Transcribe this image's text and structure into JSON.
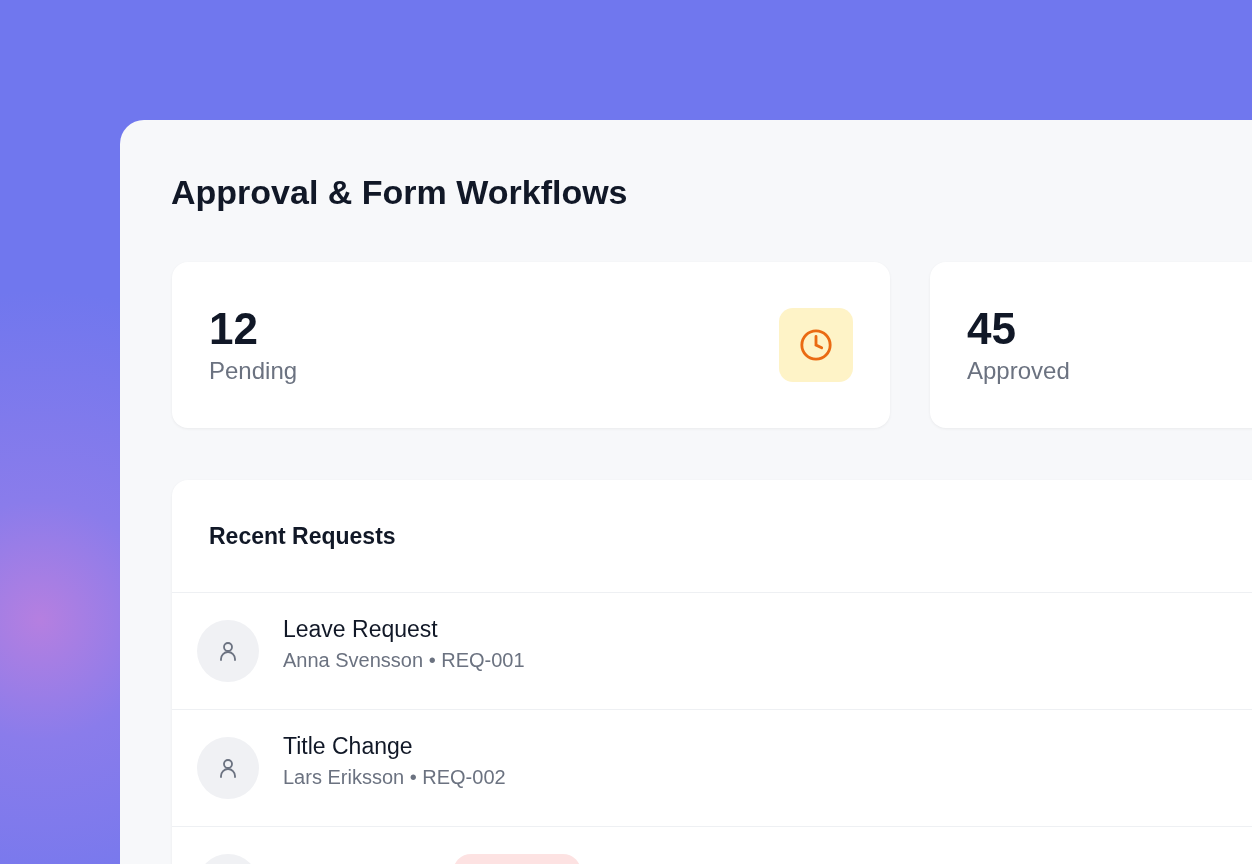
{
  "title": "Approval & Form Workflows",
  "stats": [
    {
      "value": "12",
      "label": "Pending",
      "kind": "pending"
    },
    {
      "value": "45",
      "label": "Approved",
      "kind": "approved"
    }
  ],
  "requests": {
    "title": "Recent Requests",
    "rows": [
      {
        "title": "Leave Request",
        "meta": "Anna Svensson • REQ-001"
      },
      {
        "title": "Title Change",
        "meta": "Lars Eriksson • REQ-002"
      },
      {
        "color": "#fde2e2"
      }
    ]
  }
}
